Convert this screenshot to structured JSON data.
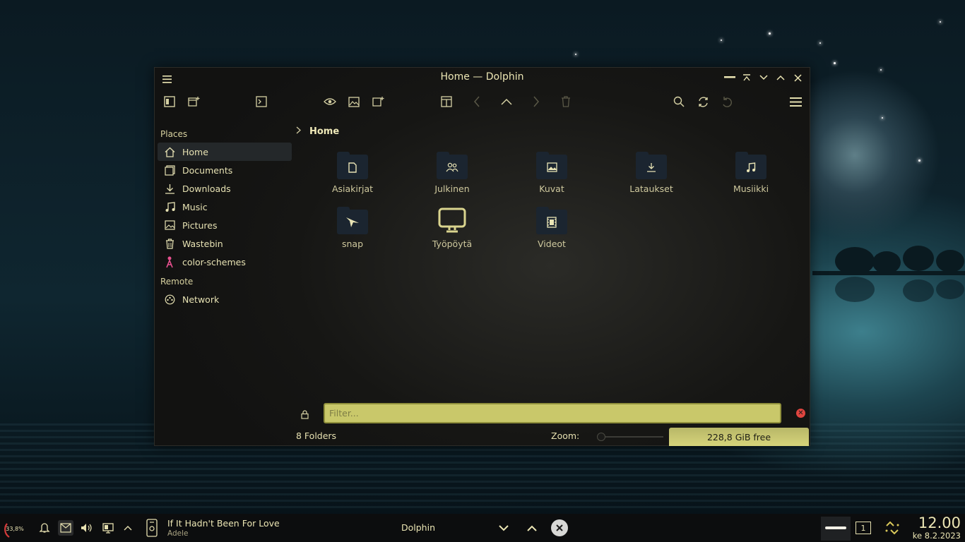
{
  "window": {
    "title": "Home — Dolphin"
  },
  "sidebar": {
    "places_heading": "Places",
    "remote_heading": "Remote",
    "places": [
      {
        "label": "Home",
        "icon": "home-icon"
      },
      {
        "label": "Documents",
        "icon": "documents-icon"
      },
      {
        "label": "Downloads",
        "icon": "downloads-icon"
      },
      {
        "label": "Music",
        "icon": "music-icon"
      },
      {
        "label": "Pictures",
        "icon": "pictures-icon"
      },
      {
        "label": "Wastebin",
        "icon": "trash-icon"
      },
      {
        "label": "color-schemes",
        "icon": "color-schemes-icon"
      }
    ],
    "remote": [
      {
        "label": "Network",
        "icon": "network-icon"
      }
    ]
  },
  "breadcrumb": {
    "current": "Home"
  },
  "files": [
    {
      "name": "Asiakirjat",
      "icon": "document-folder-icon"
    },
    {
      "name": "Julkinen",
      "icon": "public-folder-icon"
    },
    {
      "name": "Kuvat",
      "icon": "pictures-folder-icon"
    },
    {
      "name": "Lataukset",
      "icon": "downloads-folder-icon"
    },
    {
      "name": "Musiikki",
      "icon": "music-folder-icon"
    },
    {
      "name": "snap",
      "icon": "snap-folder-icon"
    },
    {
      "name": "Työpöytä",
      "icon": "desktop-icon"
    },
    {
      "name": "Videot",
      "icon": "videos-folder-icon"
    }
  ],
  "filter": {
    "placeholder": "Filter..."
  },
  "status": {
    "count": "8 Folders",
    "zoom_label": "Zoom:",
    "free_space": "228,8 GiB free"
  },
  "taskbar": {
    "cpu": "33,8%",
    "media_title": "If It Hadn't Been For Love",
    "media_artist": "Adele",
    "task_label": "Dolphin",
    "desktop_number": "1",
    "time": "12.00",
    "date": "ke 8.2.2023"
  },
  "colors": {
    "accent": "#c9c86a",
    "text": "#e8e3b0",
    "window_bg": "#161614",
    "close_badge": "#e0453f"
  }
}
